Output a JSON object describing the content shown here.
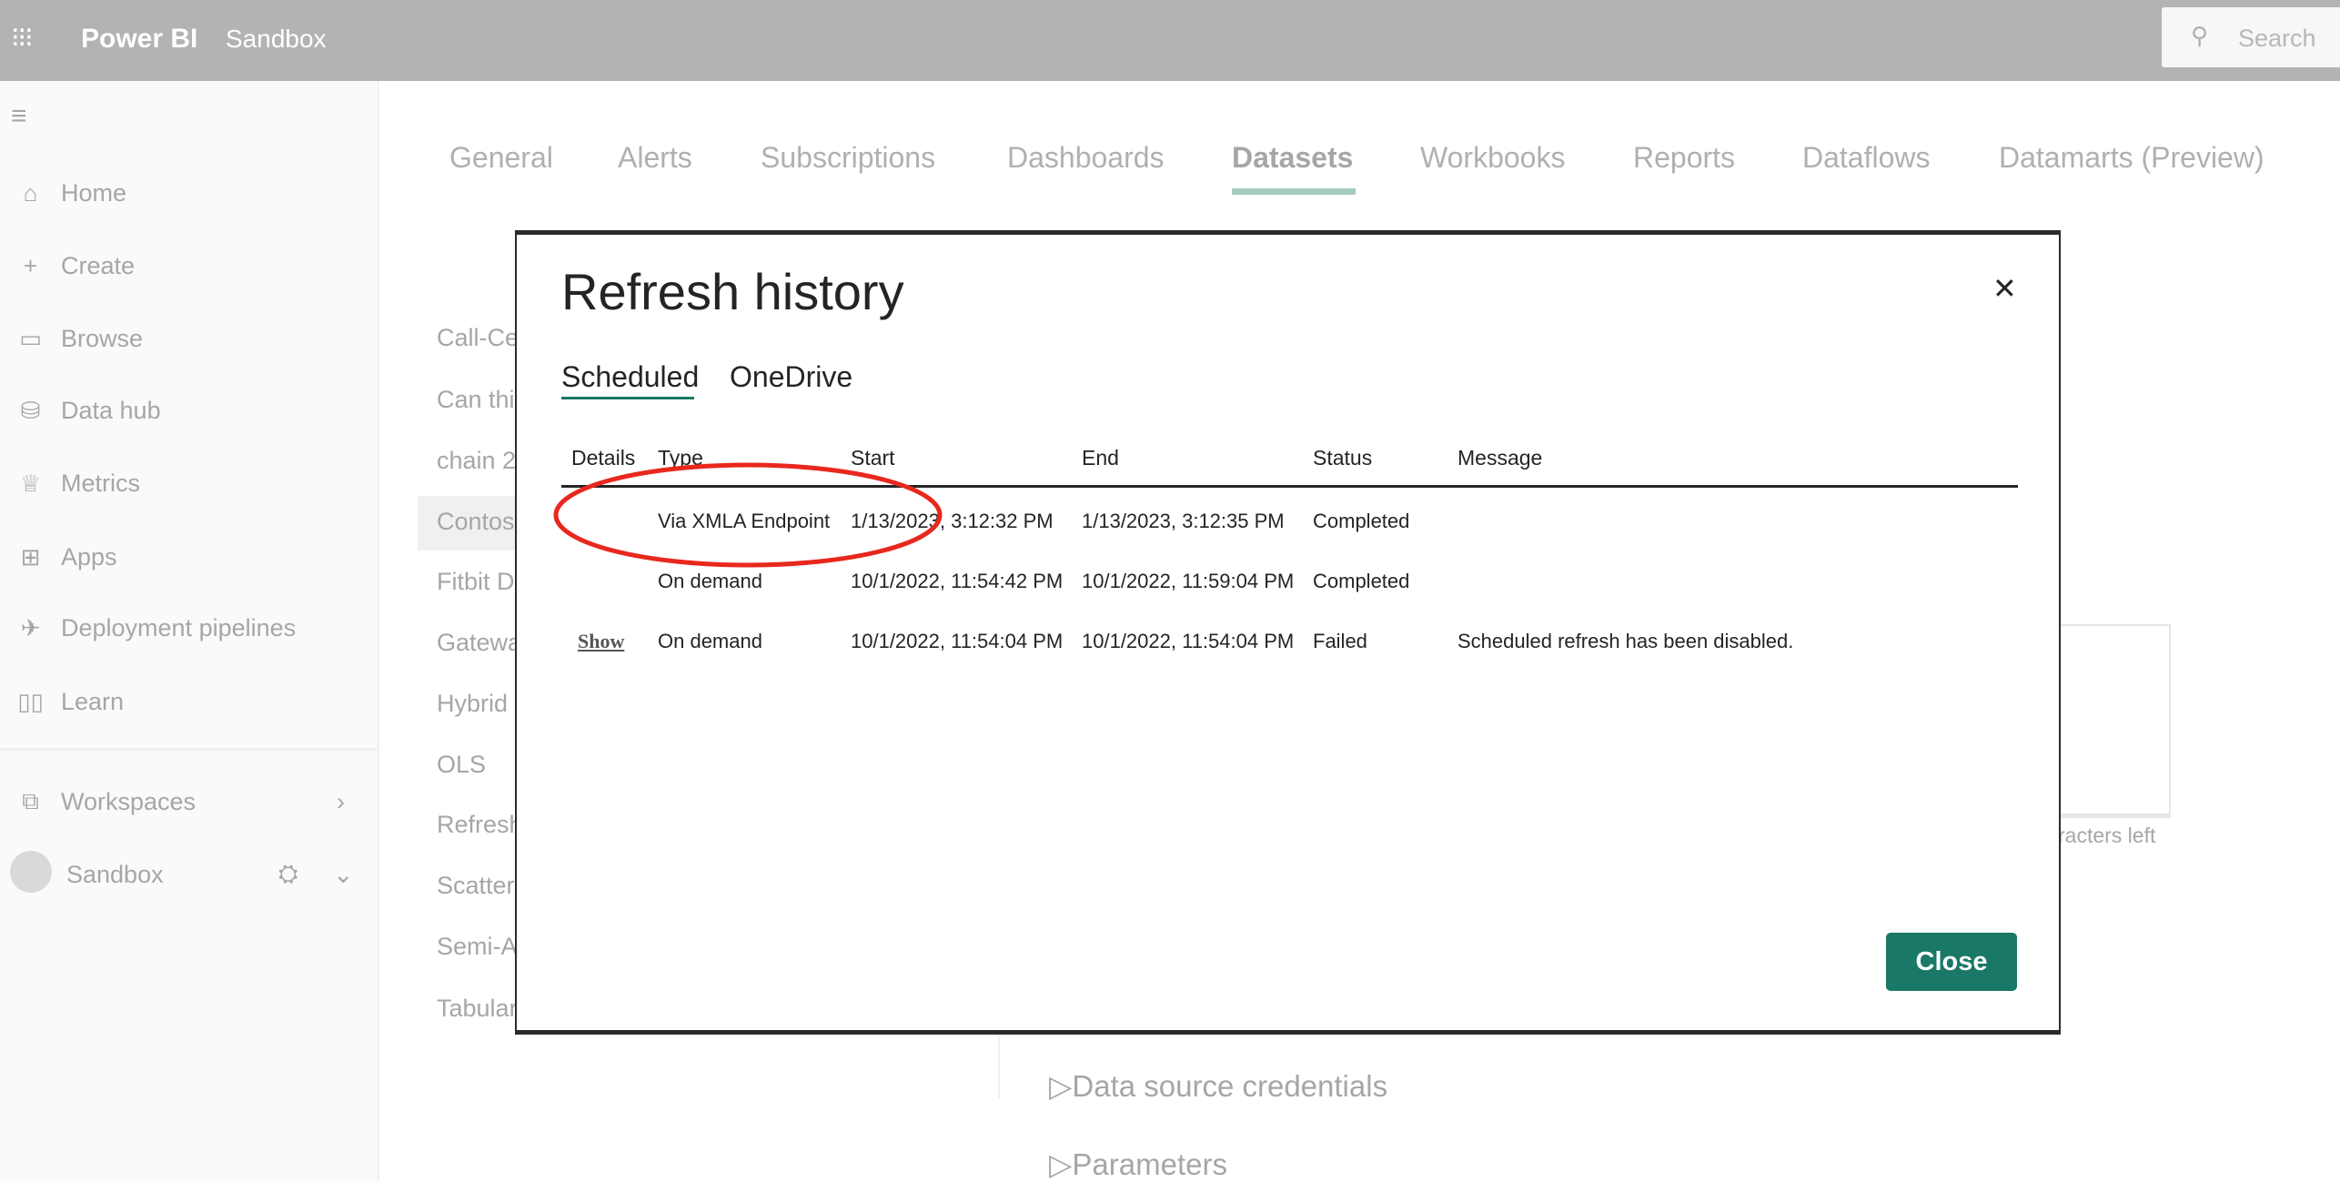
{
  "header": {
    "app_name": "Power BI",
    "workspace": "Sandbox",
    "search_placeholder": "Search"
  },
  "sidebar": {
    "items": [
      {
        "label": "Home",
        "icon": "home-icon"
      },
      {
        "label": "Create",
        "icon": "plus-icon"
      },
      {
        "label": "Browse",
        "icon": "folder-icon"
      },
      {
        "label": "Data hub",
        "icon": "database-icon"
      },
      {
        "label": "Metrics",
        "icon": "trophy-icon"
      },
      {
        "label": "Apps",
        "icon": "apps-icon"
      },
      {
        "label": "Deployment pipelines",
        "icon": "rocket-icon"
      },
      {
        "label": "Learn",
        "icon": "book-icon"
      }
    ],
    "workspaces": "Workspaces",
    "current_workspace": "Sandbox"
  },
  "settings_tabs": [
    "General",
    "Alerts",
    "Subscriptions",
    "Dashboards",
    "Datasets",
    "Workbooks",
    "Reports",
    "Dataflows",
    "Datamarts (Preview)"
  ],
  "active_tab": "Datasets",
  "dataset_list": [
    "Call-Ce",
    "Can thi",
    "chain 2",
    "Contos",
    "Fitbit D",
    "Gatewa",
    "Hybrid",
    "OLS",
    "Refresh",
    "Scatter",
    "Semi-A",
    "Tabular"
  ],
  "chars_left": "racters left",
  "sections": [
    "Data source credentials",
    "Parameters"
  ],
  "dialog": {
    "title": "Refresh history",
    "tabs": [
      "Scheduled",
      "OneDrive"
    ],
    "active_tab": "Scheduled",
    "columns": [
      "Details",
      "Type",
      "Start",
      "End",
      "Status",
      "Message"
    ],
    "rows": [
      {
        "details": "",
        "type": "Via XMLA Endpoint",
        "start": "1/13/2023, 3:12:32 PM",
        "end": "1/13/2023, 3:12:35 PM",
        "status": "Completed",
        "message": ""
      },
      {
        "details": "",
        "type": "On demand",
        "start": "10/1/2022, 11:54:42 PM",
        "end": "10/1/2022, 11:59:04 PM",
        "status": "Completed",
        "message": ""
      },
      {
        "details": "Show",
        "type": "On demand",
        "start": "10/1/2022, 11:54:04 PM",
        "end": "10/1/2022, 11:54:04 PM",
        "status": "Failed",
        "message": "Scheduled refresh has been disabled."
      }
    ],
    "close_label": "Close",
    "accent": "#1a7866",
    "annotation_color": "#e8281e"
  }
}
